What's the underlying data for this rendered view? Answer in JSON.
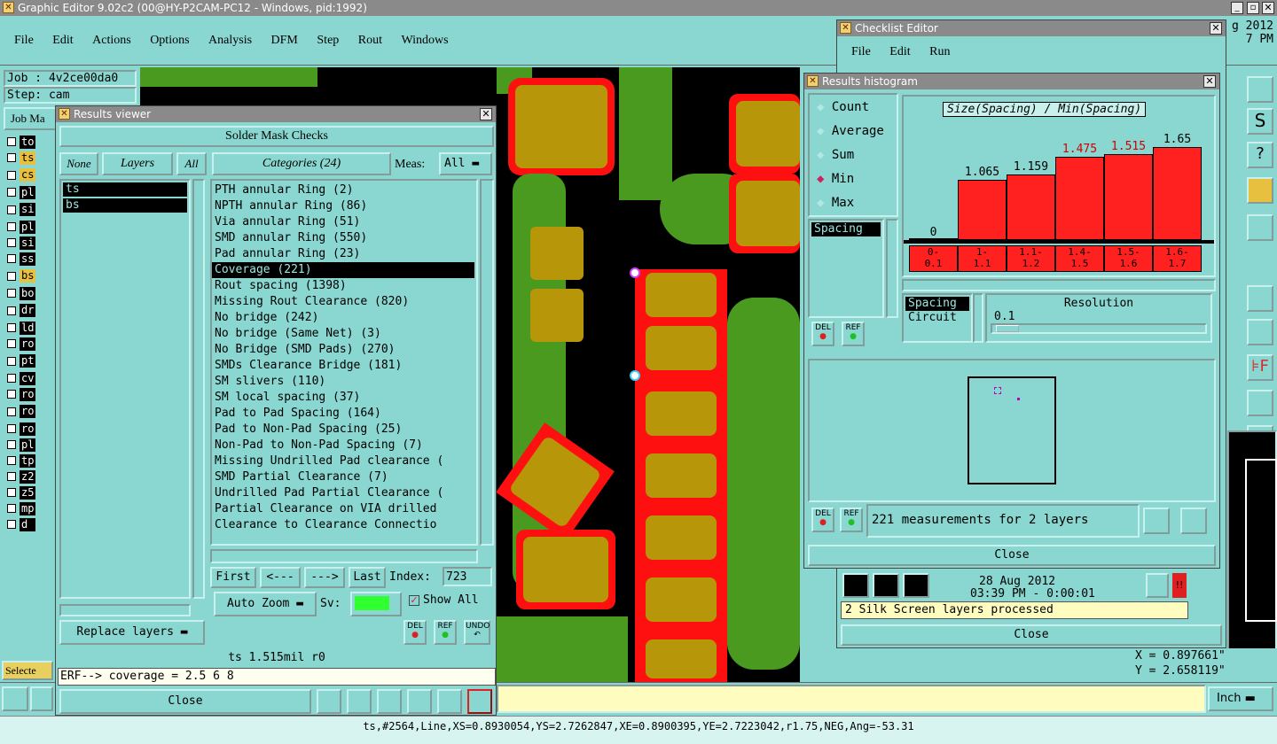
{
  "app": {
    "title": "Graphic Editor 9.02c2 (00@HY-P2CAM-PC12 - Windows, pid:1992)"
  },
  "main_menu": [
    "File",
    "Edit",
    "Actions",
    "Options",
    "Analysis",
    "DFM",
    "Step",
    "Rout",
    "Windows"
  ],
  "date_corner": {
    "line1": "g 2012",
    "line2": "7 PM"
  },
  "job": {
    "job_label": "Job : 4v2ce00da0",
    "step_label": "Step: cam",
    "job_matrix_label": "Job Ma"
  },
  "left_layers": [
    "to",
    "ts",
    "cs",
    "pl",
    "si",
    "pl",
    "si",
    "ss",
    "bs",
    "bo",
    "dr",
    "ld",
    "ro",
    "pt",
    "cv",
    "ro",
    "ro",
    "ro",
    "pl",
    "tp",
    "z2",
    "z5",
    "mp",
    "d"
  ],
  "selected_label": "Selecte",
  "results_viewer": {
    "title": "Results viewer",
    "header": "Solder Mask Checks",
    "none_btn": "None",
    "layers_btn": "Layers",
    "all_btn": "All",
    "categories_btn": "Categories (24)",
    "meas_label": "Meas:",
    "meas_value": "All",
    "layers": [
      "ts",
      "bs"
    ],
    "categories": [
      "PTH annular Ring (2)",
      "NPTH annular Ring (86)",
      "Via annular Ring (51)",
      "SMD annular Ring (550)",
      "Pad annular Ring (23)",
      "Coverage (221)",
      "Rout spacing (1398)",
      "Missing Rout Clearance (820)",
      "No bridge (242)",
      "No bridge (Same Net) (3)",
      "No Bridge (SMD Pads) (270)",
      "SMDs Clearance Bridge (181)",
      "SM slivers (110)",
      "SM local spacing (37)",
      "Pad to Pad Spacing (164)",
      "Pad to Non-Pad Spacing (25)",
      "Non-Pad to Non-Pad Spacing (7)",
      "Missing Undrilled Pad clearance (",
      "SMD Partial Clearance (7)",
      "Undrilled Pad Partial Clearance (",
      "Partial Clearance on VIA drilled",
      "Clearance to Clearance Connectio"
    ],
    "selected_index": 5,
    "first_btn": "First",
    "prev_btn": "<---",
    "next_btn": "--->",
    "last_btn": "Last",
    "index_label": "Index:",
    "index_value": "723",
    "auto_zoom": "Auto Zoom",
    "sv_label": "Sv:",
    "show_all": "Show All",
    "replace_layers": "Replace layers",
    "del": "DEL",
    "ref": "REF",
    "undo": "UNDO",
    "status": "ts 1.515mil  r0",
    "erf": "ERF--> coverage = 2.5 6 8",
    "close": "Close"
  },
  "checklist_editor": {
    "title": "Checklist Editor",
    "menu": [
      "File",
      "Edit",
      "Run"
    ],
    "date": "28 Aug 2012",
    "time": "03:39 PM - 0:00:01",
    "msg": "2 Silk Screen layers processed",
    "close": "Close"
  },
  "histogram": {
    "title": "Results histogram",
    "options": [
      "Count",
      "Average",
      "Sum",
      "Min",
      "Max"
    ],
    "selected_option": "Min",
    "chart_title": "Size(Spacing) / Min(Spacing)",
    "list": [
      "Spacing"
    ],
    "bins": [
      "0-\n0.1",
      "1-\n1.1",
      "1.1-\n1.2",
      "1.4-\n1.5",
      "1.5-\n1.6",
      "1.6-\n1.7"
    ],
    "values": [
      0,
      1.065,
      1.159,
      1.475,
      1.515,
      1.65
    ],
    "value_labels": [
      "0",
      "1.065",
      "1.159",
      "1.475",
      "1.515",
      "1.65"
    ],
    "highlight_bins": [
      3,
      4
    ],
    "group": [
      "Spacing",
      "Circuit"
    ],
    "resolution_label": "Resolution",
    "resolution_value": "0.1",
    "summary": "221 measurements for 2 layers",
    "close": "Close"
  },
  "chart_data": {
    "type": "bar",
    "title": "Size(Spacing) / Min(Spacing)",
    "categories": [
      "0-0.1",
      "1-1.1",
      "1.1-1.2",
      "1.4-1.5",
      "1.5-1.6",
      "1.6-1.7"
    ],
    "values": [
      0,
      1.065,
      1.159,
      1.475,
      1.515,
      1.65
    ],
    "colors": {
      "bar": "#ff2020",
      "highlight_label": "#d00000"
    }
  },
  "coords": {
    "x": "X = 0.897661\"",
    "y": "Y = 2.658119\""
  },
  "units": "Inch",
  "status_bar": "ts,#2564,Line,XS=0.8930054,YS=2.7262847,XE=0.8900395,YE=2.7223042,r1.75,NEG,Ang=-53.31"
}
